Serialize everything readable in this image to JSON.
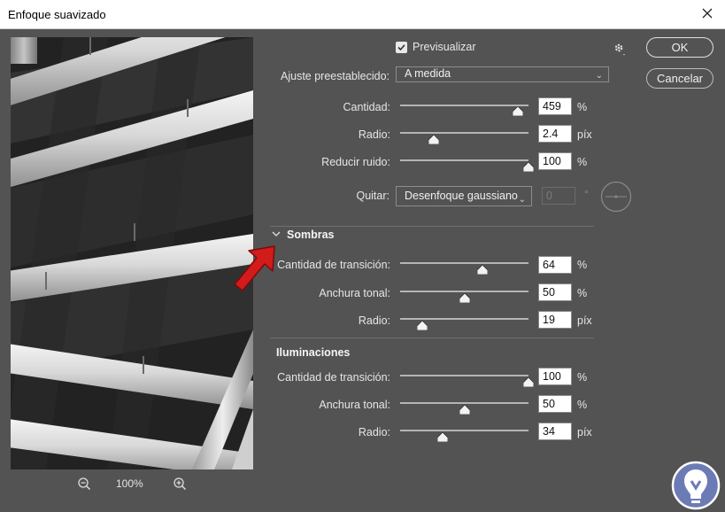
{
  "window": {
    "title": "Enfoque suavizado"
  },
  "preview": {
    "zoom": "100%"
  },
  "header": {
    "preview_label": "Previsualizar",
    "preview_checked": true,
    "ok_label": "OK",
    "cancel_label": "Cancelar"
  },
  "preset": {
    "label": "Ajuste preestablecido:",
    "value": "A medida"
  },
  "main": {
    "cantidad": {
      "label": "Cantidad:",
      "value": "459",
      "unit": "%",
      "slider_pct": 92
    },
    "radio": {
      "label": "Radio:",
      "value": "2.4",
      "unit": "píx",
      "slider_pct": 26
    },
    "ruido": {
      "label": "Reducir ruido:",
      "value": "100",
      "unit": "%",
      "slider_pct": 100
    },
    "quitar": {
      "label": "Quitar:",
      "value": "Desenfoque gaussiano",
      "angle": "0",
      "angle_unit": "°"
    }
  },
  "sombras": {
    "title": "Sombras",
    "transicion": {
      "label": "Cantidad de transición:",
      "value": "64",
      "unit": "%",
      "slider_pct": 64
    },
    "anchura": {
      "label": "Anchura tonal:",
      "value": "50",
      "unit": "%",
      "slider_pct": 50
    },
    "radio": {
      "label": "Radio:",
      "value": "19",
      "unit": "píx",
      "slider_pct": 17
    }
  },
  "iluminaciones": {
    "title": "Iluminaciones",
    "transicion": {
      "label": "Cantidad de transición:",
      "value": "100",
      "unit": "%",
      "slider_pct": 100
    },
    "anchura": {
      "label": "Anchura tonal:",
      "value": "50",
      "unit": "%",
      "slider_pct": 50
    },
    "radio": {
      "label": "Radio:",
      "value": "34",
      "unit": "píx",
      "slider_pct": 33
    }
  },
  "icons": {
    "close": "close-icon",
    "gear": "gear-icon",
    "zoom_out": "zoom-out-icon",
    "zoom_in": "zoom-in-icon",
    "dial": "angle-dial-icon",
    "arrow": "red-arrow-icon",
    "logo": "logo-icon"
  },
  "colors": {
    "panel": "#535353",
    "accent_arrow": "#d21b1b",
    "logo": "#6d7bb5"
  }
}
